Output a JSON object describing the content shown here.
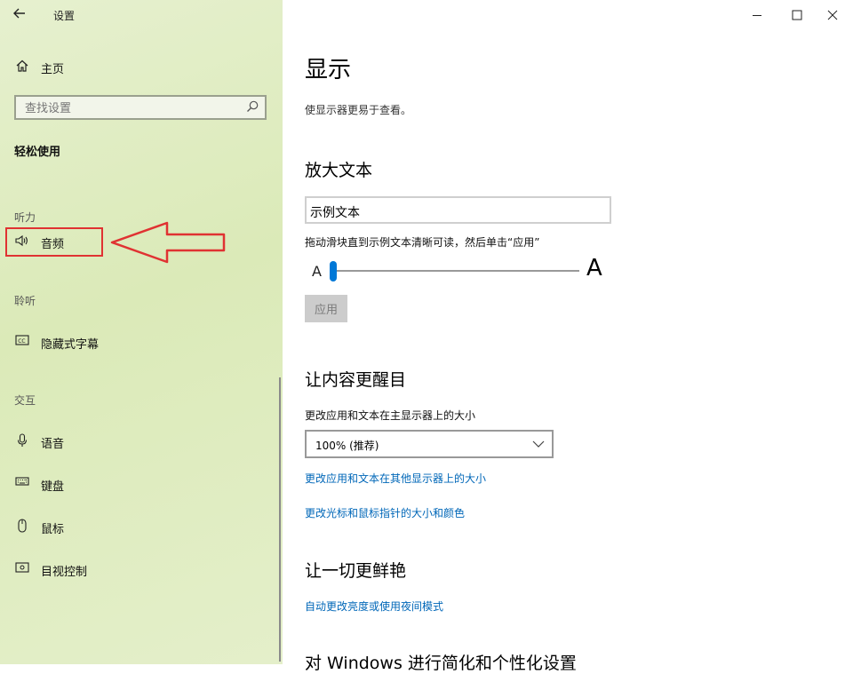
{
  "window": {
    "back_icon": "arrow-left-icon",
    "title": "设置",
    "controls": [
      "minimize-icon",
      "maximize-icon",
      "close-icon"
    ]
  },
  "sidebar": {
    "home_label": "主页",
    "search_placeholder": "查找设置",
    "group_title": "轻松使用",
    "sections": {
      "hearing": "听力",
      "listening": "聆听",
      "interaction": "交互"
    },
    "items": {
      "audio": "音频",
      "captions": "隐藏式字幕",
      "speech": "语音",
      "keyboard": "键盘",
      "mouse": "鼠标",
      "eye_control": "目视控制"
    },
    "annotation_color": "#e03232"
  },
  "main": {
    "title": "显示",
    "description": "使显示器更易于查看。",
    "enlarge_text": {
      "heading": "放大文本",
      "sample_text": "示例文本",
      "hint": "拖动滑块直到示例文本清晰可读，然后单击“应用”",
      "small_a": "A",
      "large_a": "A",
      "slider_value_fraction": 0.0,
      "apply_label": "应用"
    },
    "bigger": {
      "heading": "让内容更醒目",
      "scale_label": "更改应用和文本在主显示器上的大小",
      "scale_value": "100% (推荐)",
      "link_other_displays": "更改应用和文本在其他显示器上的大小",
      "link_cursor": "更改光标和鼠标指针的大小和颜色"
    },
    "brighter": {
      "heading": "让一切更鲜艳",
      "link_night_light": "自动更改亮度或使用夜间模式"
    },
    "personalize": {
      "heading": "对 Windows 进行简化和个性化设置"
    },
    "accent_color": "#0078d7",
    "link_color": "#0067b8"
  }
}
